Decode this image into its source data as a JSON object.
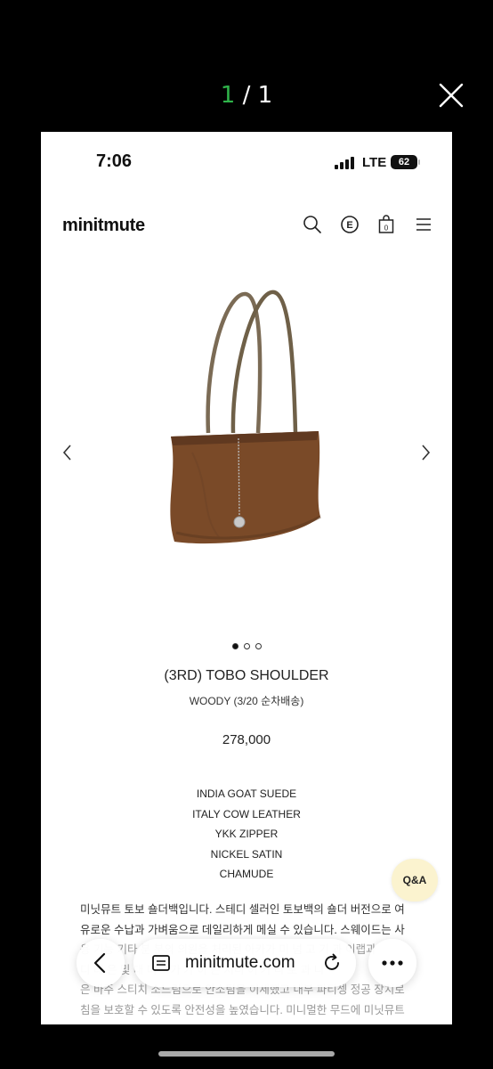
{
  "viewer": {
    "current_page": "1",
    "separator": " / ",
    "total_pages": "1",
    "close_icon": "close-icon"
  },
  "status_bar": {
    "time": "7:06",
    "network": "LTE",
    "battery": "62"
  },
  "header": {
    "logo": "minitmute",
    "icons": [
      "search-icon",
      "e-coin-icon",
      "bag-icon",
      "menu-icon"
    ],
    "cart_count": "0",
    "e_label": "E"
  },
  "gallery": {
    "image_icon": "tote-bag-image",
    "prev_icon": "chevron-left-icon",
    "next_icon": "chevron-right-icon",
    "dots": 3,
    "active_dot": 0,
    "bag_color": "#7a4a28"
  },
  "product": {
    "name": "(3RD) TOBO SHOULDER",
    "color": "WOODY (3/20 순차배송)",
    "price": "278,000",
    "materials": [
      "INDIA GOAT SUEDE",
      "ITALY COW LEATHER",
      "YKK ZIPPER",
      "NICKEL SATIN",
      "CHAMUDE"
    ]
  },
  "description": {
    "lines": [
      "미닛뮤트 토보 숄더백입니다. 스테디 셀러인 토보백의 숄더 버전으로 여",
      "유로운 수납과 가벼움으로 데일리하게 메실 수 있습니다. 스웨이드는 사",
      "용 기능 기타 분 분의 의원을 처리된 아카가 미 넘 고 기 과 이랩과",
      "디 레 은 및 대 미 그가 가 이 는 지니 이 기 니 로 과 니",
      "은 바주 스티치 소느림으로 안소팀을 이세했고 내부 파티셍 정공 장치로",
      "침을 보호할 수 있도록 안전성을 높였습니다. 미니멀한 무드에 미닛뮤트"
    ]
  },
  "qa_button": {
    "label": "Q&A"
  },
  "browser": {
    "url": "minitmute.com",
    "back_icon": "chevron-left-icon",
    "tabs_icon": "reader-icon",
    "reload_icon": "reload-icon",
    "more_icon": "ellipsis-icon"
  }
}
